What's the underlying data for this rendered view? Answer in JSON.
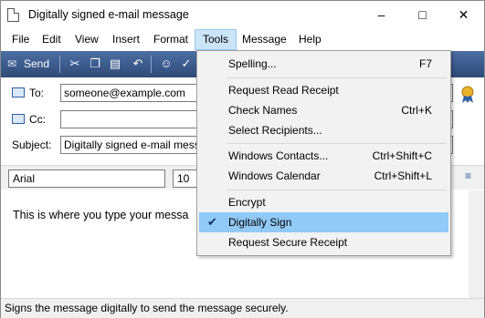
{
  "window": {
    "title": "Digitally signed e-mail message"
  },
  "menubar": {
    "items": [
      "File",
      "Edit",
      "View",
      "Insert",
      "Format",
      "Tools",
      "Message",
      "Help"
    ],
    "active": "Tools"
  },
  "toolbar": {
    "send_label": "Send"
  },
  "header": {
    "to_label": "To:",
    "to_value": "someone@example.com",
    "cc_label": "Cc:",
    "cc_value": "",
    "subject_label": "Subject:",
    "subject_value": "Digitally signed e-mail mess"
  },
  "format": {
    "font": "Arial",
    "size": "10"
  },
  "editor": {
    "body": "This is where you type your messa"
  },
  "status": {
    "text": "Signs the message digitally to send the message securely."
  },
  "tools_menu": {
    "items": [
      {
        "label": "Spelling...",
        "shortcut": "F7"
      },
      {
        "label": "Request Read Receipt",
        "shortcut": ""
      },
      {
        "label": "Check Names",
        "shortcut": "Ctrl+K"
      },
      {
        "label": "Select Recipients...",
        "shortcut": ""
      },
      {
        "label": "Windows Contacts...",
        "shortcut": "Ctrl+Shift+C"
      },
      {
        "label": "Windows Calendar",
        "shortcut": "Ctrl+Shift+L"
      },
      {
        "label": "Encrypt",
        "shortcut": ""
      },
      {
        "label": "Digitally Sign",
        "shortcut": "",
        "checked": true,
        "highlighted": true
      },
      {
        "label": "Request Secure Receipt",
        "shortcut": ""
      }
    ]
  },
  "colors": {
    "highlight": "#91c9f7",
    "toolbar": "#3c5a8c",
    "menu_active": "#cce4f7"
  }
}
